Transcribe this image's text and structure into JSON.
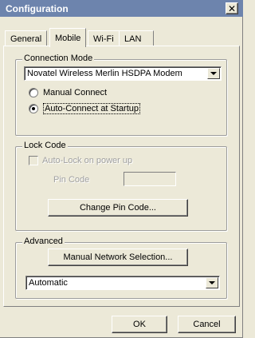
{
  "window": {
    "title": "Configuration",
    "close_label": "✕"
  },
  "tabs": [
    "General",
    "Mobile",
    "Wi-Fi",
    "LAN"
  ],
  "active_tab": "Mobile",
  "connection_mode": {
    "label": "Connection Mode",
    "modem_selected": "Novatel Wireless Merlin HSDPA Modem",
    "radio_manual": "Manual Connect",
    "radio_auto": "Auto-Connect at Startup",
    "selected": "Auto-Connect at Startup"
  },
  "lock_code": {
    "label": "Lock Code",
    "autolock_label": "Auto-Lock on power up",
    "pin_label": "Pin Code",
    "pin_value": "",
    "change_pin_button": "Change Pin Code..."
  },
  "advanced": {
    "label": "Advanced",
    "manual_network_button": "Manual Network Selection...",
    "network_selected": "Automatic"
  },
  "footer": {
    "ok_label": "OK",
    "cancel_label": "Cancel"
  }
}
